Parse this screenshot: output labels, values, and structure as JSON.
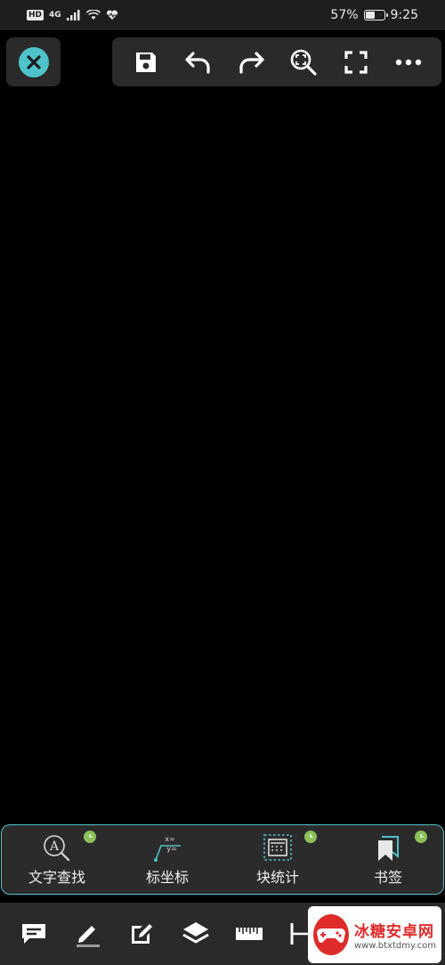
{
  "status_bar": {
    "hd": "HD",
    "network": "4G",
    "battery_percent": "57%",
    "battery_level": 0.57,
    "time": "9:25"
  },
  "colors": {
    "accent": "#4ec3c9",
    "panel": "#2a2a2a",
    "badge_green": "#8cc05a",
    "canvas": "#000000"
  },
  "top_toolbar": {
    "close_icon": "close-icon",
    "buttons": [
      {
        "icon": "save-icon"
      },
      {
        "icon": "undo-icon"
      },
      {
        "icon": "redo-icon"
      },
      {
        "icon": "zoom-extents-icon"
      },
      {
        "icon": "fullscreen-icon"
      },
      {
        "icon": "more-icon"
      }
    ]
  },
  "quick_panel": {
    "items": [
      {
        "label": "文字查找",
        "icon": "text-search-icon"
      },
      {
        "label": "标坐标",
        "icon": "coordinate-icon"
      },
      {
        "label": "块统计",
        "icon": "block-count-icon"
      },
      {
        "label": "书签",
        "icon": "bookmark-icon"
      }
    ]
  },
  "bottom_toolbar": {
    "buttons": [
      {
        "icon": "comment-icon"
      },
      {
        "icon": "pen-icon"
      },
      {
        "icon": "edit-icon"
      },
      {
        "icon": "layers-icon"
      },
      {
        "icon": "ruler-icon"
      },
      {
        "icon": "dimension-icon"
      }
    ]
  },
  "watermark": {
    "title": "冰糖安卓网",
    "url": "www.btxtdmy.com"
  }
}
